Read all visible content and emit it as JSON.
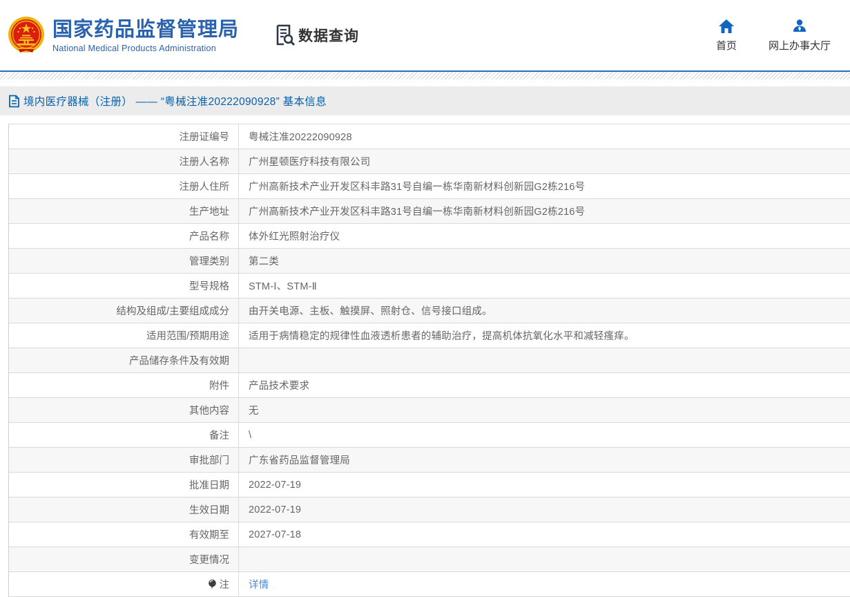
{
  "header": {
    "org_name_zh": "国家药品监督管理局",
    "org_name_en": "National Medical Products Administration",
    "section_title": "数据查询",
    "nav": [
      {
        "label": "首页"
      },
      {
        "label": "网上办事大厅"
      }
    ]
  },
  "breadcrumb": {
    "text": "境内医疗器械（注册） —— “粤械注准20222090928” 基本信息"
  },
  "table": {
    "rows": [
      {
        "label": "注册证编号",
        "value": "粤械注准20222090928"
      },
      {
        "label": "注册人名称",
        "value": "广州星顿医疗科技有限公司"
      },
      {
        "label": "注册人住所",
        "value": "广州高新技术产业开发区科丰路31号自编一栋华南新材料创新园G2栋216号"
      },
      {
        "label": "生产地址",
        "value": "广州高新技术产业开发区科丰路31号自编一栋华南新材料创新园G2栋216号"
      },
      {
        "label": "产品名称",
        "value": "体外红光照射治疗仪"
      },
      {
        "label": "管理类别",
        "value": "第二类"
      },
      {
        "label": "型号规格",
        "value": "STM-Ⅰ、STM-Ⅱ"
      },
      {
        "label": "结构及组成/主要组成成分",
        "value": "由开关电源、主板、触摸屏、照射仓、信号接口组成。"
      },
      {
        "label": "适用范围/预期用途",
        "value": "适用于病情稳定的规律性血液透析患者的辅助治疗，提高机体抗氧化水平和减轻瘙痒。"
      },
      {
        "label": "产品储存条件及有效期",
        "value": ""
      },
      {
        "label": "附件",
        "value": "产品技术要求"
      },
      {
        "label": "其他内容",
        "value": "无"
      },
      {
        "label": "备注",
        "value": "\\"
      },
      {
        "label": "审批部门",
        "value": "广东省药品监督管理局"
      },
      {
        "label": "批准日期",
        "value": "2022-07-19"
      },
      {
        "label": "生效日期",
        "value": "2022-07-19"
      },
      {
        "label": "有效期至",
        "value": "2027-07-18"
      },
      {
        "label": "变更情况",
        "value": ""
      },
      {
        "label": "注",
        "value": "详情"
      }
    ]
  },
  "colors": {
    "brand_blue": "#2b62ae",
    "top_line_blue": "#2a6bb5",
    "breadcrumb_blue": "#0561ae",
    "nav_icon_blue": "#1266c0",
    "link_blue": "#3e8ede",
    "row_alt_gray": "#f7f7f7",
    "breadcrumb_bg": "#ececec"
  }
}
